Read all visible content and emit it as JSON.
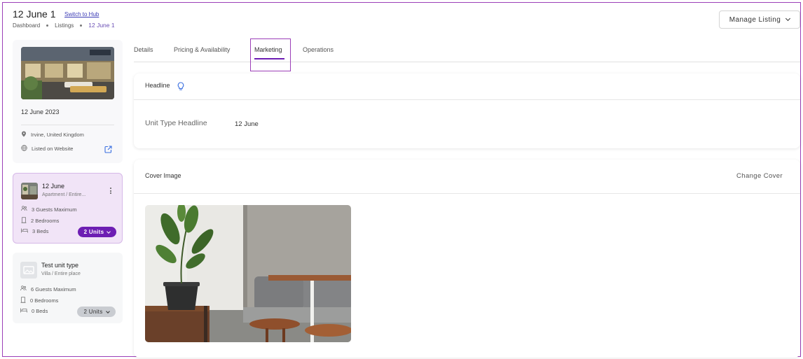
{
  "header": {
    "title": "12 June 1",
    "switch_link": "Switch to Hub",
    "breadcrumb": [
      "Dashboard",
      "Listings",
      "12 June 1"
    ],
    "manage_button": "Manage Listing"
  },
  "summary": {
    "date": "12 June 2023",
    "location": "Irvine, United Kingdom",
    "listed": "Listed on Website"
  },
  "units": [
    {
      "name": "12 June",
      "type": "Apartment / Entire...",
      "guests": "3 Guests Maximum",
      "bedrooms": "2 Bedrooms",
      "beds": "3 Beds",
      "units_label": "2 Units"
    },
    {
      "name": "Test unit type",
      "type": "Villa / Entire place",
      "guests": "6 Guests Maximum",
      "bedrooms": "0 Bedrooms",
      "beds": "0 Beds",
      "units_label": "2 Units"
    }
  ],
  "tabs": [
    "Details",
    "Pricing & Availability",
    "Marketing",
    "Operations"
  ],
  "active_tab": "Marketing",
  "headline_panel": {
    "title": "Headline",
    "field_label": "Unit Type Headline",
    "field_value": "12 June"
  },
  "cover_panel": {
    "title": "Cover Image",
    "change_label": "Change Cover"
  },
  "colors": {
    "accent": "#6d1eb3",
    "frame": "#9c3fb8",
    "active_card": "#f1e4f7"
  }
}
